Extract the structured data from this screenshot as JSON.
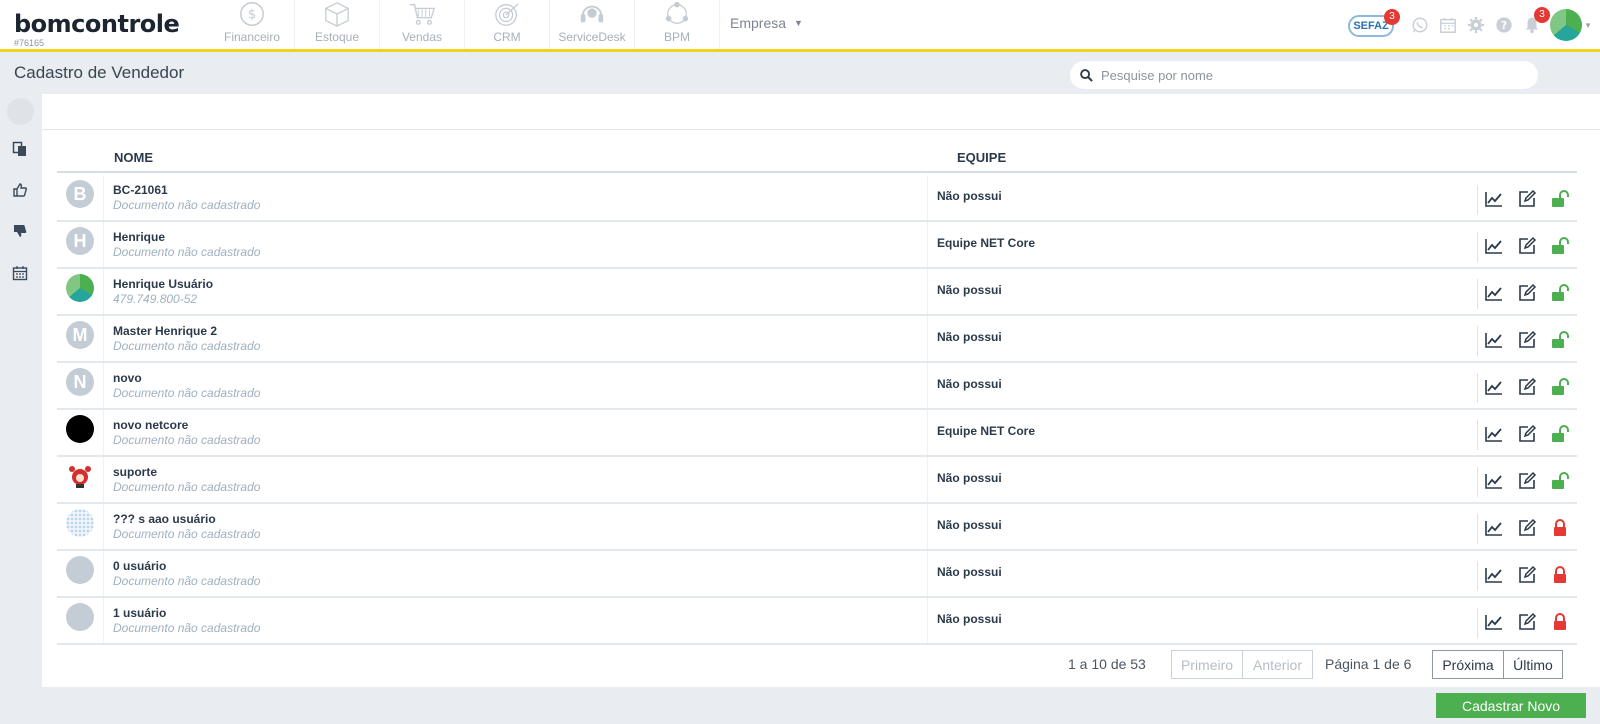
{
  "brand": {
    "logo_text": "bomcontrole",
    "company_code": "#76165"
  },
  "modules": [
    {
      "label": "Financeiro",
      "icon": "dollar-coin-icon"
    },
    {
      "label": "Estoque",
      "icon": "box-icon"
    },
    {
      "label": "Vendas",
      "icon": "shopping-cart-icon"
    },
    {
      "label": "CRM",
      "icon": "target-icon"
    },
    {
      "label": "ServiceDesk",
      "icon": "headset-icon"
    },
    {
      "label": "BPM",
      "icon": "workflow-icon"
    }
  ],
  "empresa_label": "Empresa",
  "header_right": {
    "sefaz_label": "SEFAZ",
    "sefaz_badge": "3",
    "notifications_badge": "3"
  },
  "page_title": "Cadastro de Vendedor",
  "search": {
    "placeholder": "Pesquise por nome"
  },
  "table": {
    "headers": {
      "name": "NOME",
      "team": "EQUIPE"
    },
    "rows": [
      {
        "initial": "B",
        "name": "BC-21061",
        "doc": "Documento não cadastrado",
        "team": "Não possui",
        "locked": false
      },
      {
        "initial": "H",
        "name": "Henrique",
        "doc": "Documento não cadastrado",
        "team": "Equipe NET Core",
        "locked": false
      },
      {
        "initial": "",
        "name": "Henrique Usuário",
        "doc": "479.749.800-52",
        "team": "Não possui",
        "locked": false
      },
      {
        "initial": "M",
        "name": "Master Henrique 2",
        "doc": "Documento não cadastrado",
        "team": "Não possui",
        "locked": false
      },
      {
        "initial": "N",
        "name": "novo",
        "doc": "Documento não cadastrado",
        "team": "Não possui",
        "locked": false
      },
      {
        "initial": "",
        "name": "novo netcore",
        "doc": "Documento não cadastrado",
        "team": "Equipe NET Core",
        "locked": false
      },
      {
        "initial": "",
        "name": "suporte",
        "doc": "Documento não cadastrado",
        "team": "Não possui",
        "locked": false
      },
      {
        "initial": "",
        "name": "??? s aao usuário",
        "doc": "Documento não cadastrado",
        "team": "Não possui",
        "locked": true
      },
      {
        "initial": "",
        "name": "0 usuário",
        "doc": "Documento não cadastrado",
        "team": "Não possui",
        "locked": true
      },
      {
        "initial": "",
        "name": "1 usuário",
        "doc": "Documento não cadastrado",
        "team": "Não possui",
        "locked": true
      }
    ]
  },
  "pagination": {
    "count_text": "1 a 10 de 53",
    "first": "Primeiro",
    "previous": "Anterior",
    "page_text": "Página 1 de 6",
    "next": "Próxima",
    "last": "Último"
  },
  "new_button": "Cadastrar Novo",
  "colors": {
    "accent_yellow": "#f2d21b",
    "unlock_green": "#4caf50",
    "lock_red": "#e53935",
    "primary_button": "#4caf50"
  }
}
